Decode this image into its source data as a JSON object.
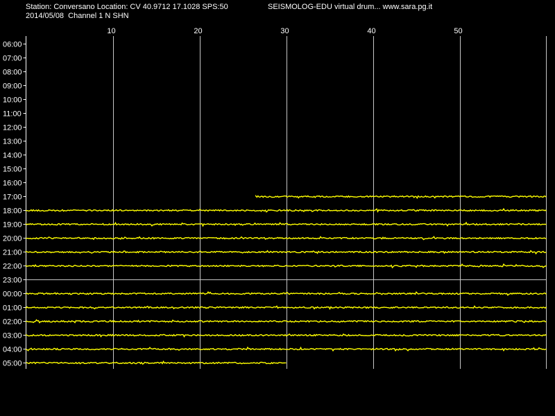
{
  "header": {
    "station_line": "Station: Conversano Location: CV 40.9712 17.1028 SPS:50",
    "app_line": "SEISMOLOG-EDU virtual drum... www.sara.pg.it",
    "date_line": "2014/05/08  Channel 1 N SHN"
  },
  "drum": {
    "hour_labels": [
      "06:00",
      "07:00",
      "08:00",
      "09:00",
      "10:00",
      "11:00",
      "12:00",
      "13:00",
      "14:00",
      "15:00",
      "16:00",
      "17:00",
      "18:00",
      "19:00",
      "20:00",
      "21:00",
      "22:00",
      "23:00",
      "00:00",
      "01:00",
      "02:00",
      "03:00",
      "04:00",
      "05:00"
    ],
    "minute_ticks": [
      10,
      20,
      30,
      40,
      50
    ],
    "minutes_per_row": 60,
    "trace_color": "#ffff00",
    "grid_color": "#c8c8c8",
    "background_color": "#000000",
    "text_color": "#ffffff",
    "traces": [
      {
        "hour": "17:00",
        "start_min": 26.5,
        "end_min": 60
      },
      {
        "hour": "18:00",
        "start_min": 0,
        "end_min": 60
      },
      {
        "hour": "19:00",
        "start_min": 0,
        "end_min": 60
      },
      {
        "hour": "20:00",
        "start_min": 0,
        "end_min": 60
      },
      {
        "hour": "21:00",
        "start_min": 0,
        "end_min": 60
      },
      {
        "hour": "22:00",
        "start_min": 0,
        "end_min": 60
      },
      {
        "hour": "00:00",
        "start_min": 0,
        "end_min": 60
      },
      {
        "hour": "01:00",
        "start_min": 0,
        "end_min": 60
      },
      {
        "hour": "02:00",
        "start_min": 0,
        "end_min": 60
      },
      {
        "hour": "03:00",
        "start_min": 0,
        "end_min": 60
      },
      {
        "hour": "04:00",
        "start_min": 0,
        "end_min": 60
      },
      {
        "hour": "05:00",
        "start_min": 0,
        "end_min": 30
      }
    ]
  }
}
